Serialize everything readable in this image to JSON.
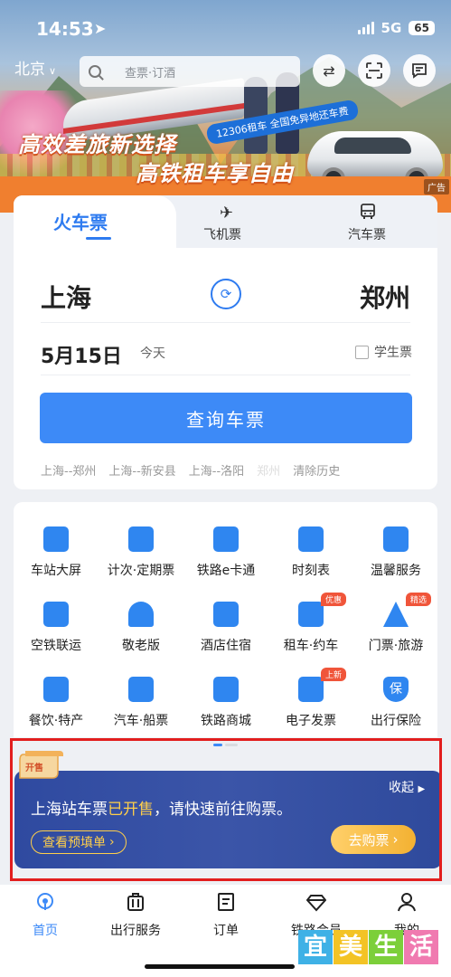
{
  "status_bar": {
    "time": "14:53",
    "network": "5G",
    "battery": "65"
  },
  "top_nav": {
    "city": "北京",
    "search_placeholder": "查票·订酒"
  },
  "banner": {
    "slogan_line1": "高效差旅新选择",
    "slogan_line2": "高铁租车享自由",
    "promo_tag": "12306租车 全国免异地还车费",
    "ad_label": "广告"
  },
  "ticket_tabs": [
    {
      "label": "火车票",
      "icon": "train-icon",
      "active": true
    },
    {
      "label": "飞机票",
      "icon": "airplane-icon",
      "active": false
    },
    {
      "label": "汽车票",
      "icon": "bus-icon",
      "active": false
    }
  ],
  "search_form": {
    "from": "上海",
    "to": "郑州",
    "date": "5月15日",
    "date_hint": "今天",
    "student_label": "学生票",
    "student_checked": false,
    "query_button": "查询车票"
  },
  "history": {
    "items": [
      "上海--郑州",
      "上海--新安县",
      "上海--洛阳",
      "郑州"
    ],
    "clear_label": "清除历史"
  },
  "services": [
    {
      "label": "车站大屏",
      "icon": "calendar-icon"
    },
    {
      "label": "计次·定期票",
      "icon": "ticket-card-icon"
    },
    {
      "label": "铁路e卡通",
      "icon": "ecard-icon"
    },
    {
      "label": "时刻表",
      "icon": "timetable-icon"
    },
    {
      "label": "温馨服务",
      "icon": "heart-box-icon"
    },
    {
      "label": "空铁联运",
      "icon": "plane-train-icon"
    },
    {
      "label": "敬老版",
      "icon": "heart-icon"
    },
    {
      "label": "酒店住宿",
      "icon": "hotel-icon"
    },
    {
      "label": "租车·约车",
      "icon": "car-icon",
      "badge": "优惠"
    },
    {
      "label": "门票·旅游",
      "icon": "mountain-icon",
      "badge": "精选"
    },
    {
      "label": "餐饮·特产",
      "icon": "dining-icon"
    },
    {
      "label": "汽车·船票",
      "icon": "bus-ship-icon"
    },
    {
      "label": "铁路商城",
      "icon": "store-icon"
    },
    {
      "label": "电子发票",
      "icon": "invoice-icon",
      "badge": "上新"
    },
    {
      "label": "出行保险",
      "icon": "shield-icon",
      "badge_text": "保"
    }
  ],
  "notice": {
    "collapse_label": "收起",
    "text_prefix": "上海站车票",
    "text_highlight": "已开售",
    "text_suffix": "，请快速前往购票。",
    "prefill_button": "查看预填单",
    "buy_button": "去购票",
    "scroll_label": "开售"
  },
  "bottom_nav": [
    {
      "label": "首页",
      "icon": "home-icon",
      "active": true
    },
    {
      "label": "出行服务",
      "icon": "luggage-icon",
      "active": false
    },
    {
      "label": "订单",
      "icon": "order-icon",
      "active": false
    },
    {
      "label": "铁路会员",
      "icon": "diamond-icon",
      "active": false
    },
    {
      "label": "我的",
      "icon": "user-icon",
      "active": false
    }
  ],
  "watermark": [
    "宜",
    "美",
    "生",
    "活"
  ],
  "colors": {
    "primary": "#2e7bf0",
    "notice_bg": "#34509f",
    "highlight": "#ffcf4a",
    "badge": "#f0553a",
    "frame": "#e21e1e"
  }
}
